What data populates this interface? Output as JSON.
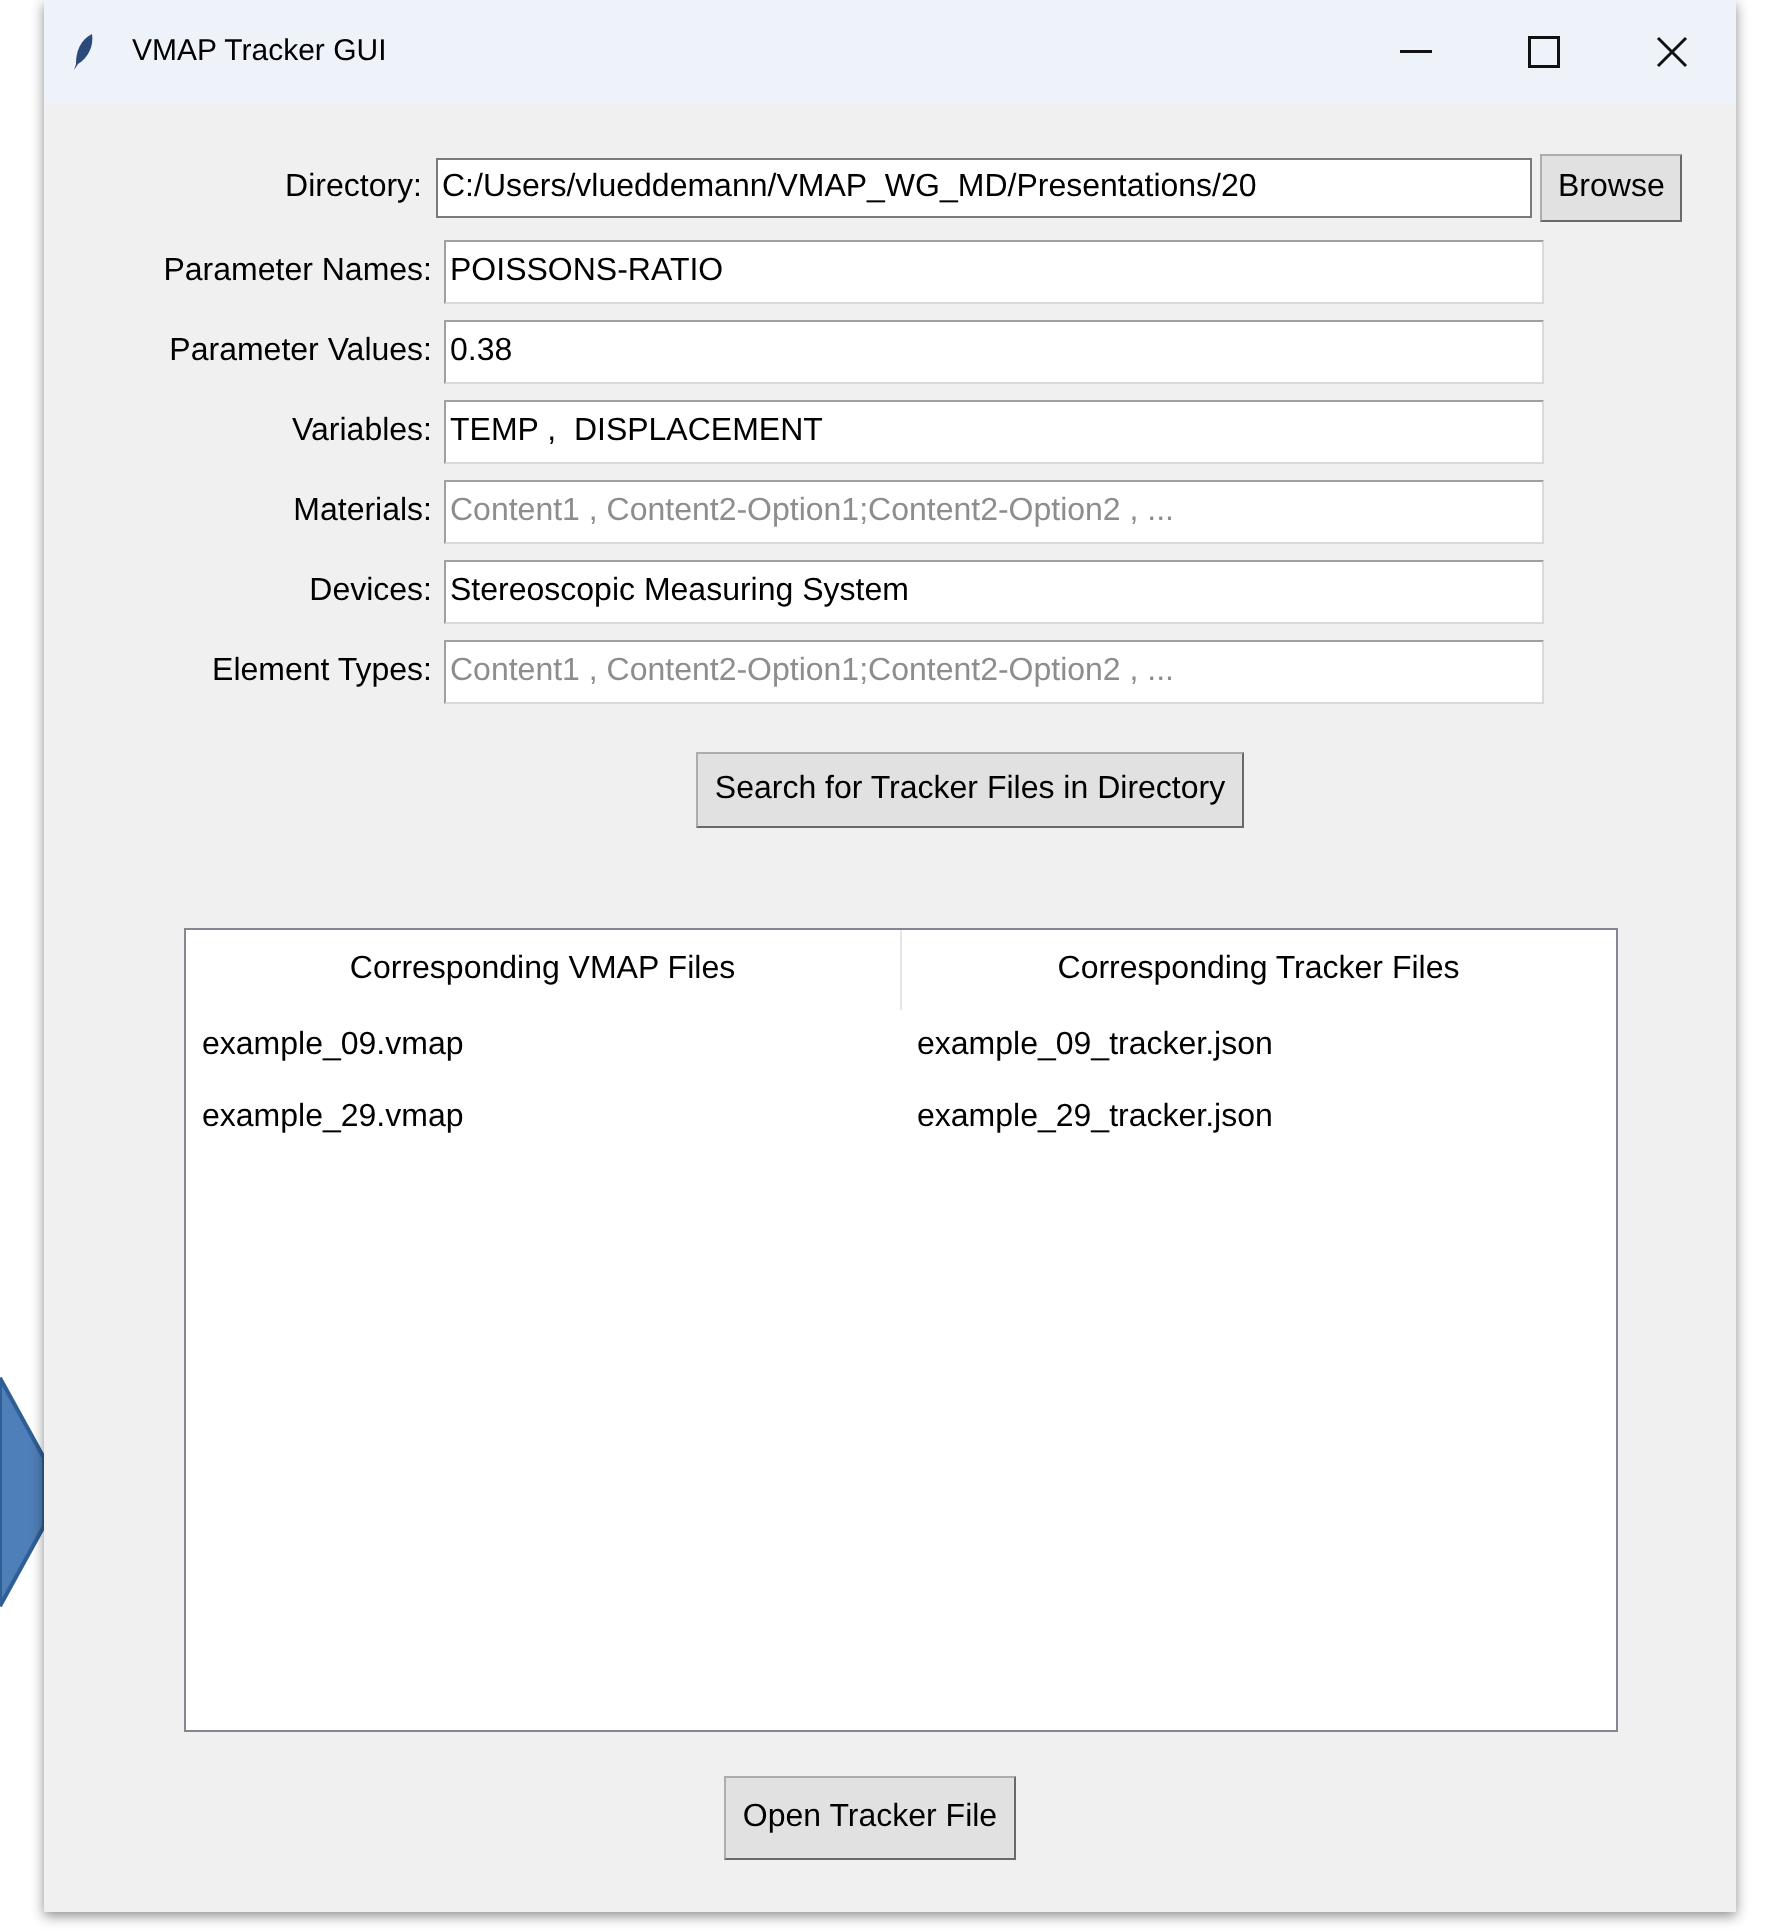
{
  "window": {
    "title": "VMAP Tracker GUI"
  },
  "directory": {
    "label": "Directory:",
    "value": "C:/Users/vlueddemann/VMAP_WG_MD/Presentations/20",
    "button": "Browse"
  },
  "fields": [
    {
      "label": "Parameter Names:",
      "value": "POISSONS-RATIO"
    },
    {
      "label": "Parameter Values:",
      "value": "0.38"
    },
    {
      "label": "Variables:",
      "value": "TEMP ,  DISPLACEMENT"
    },
    {
      "label": "Materials:",
      "placeholder": "Content1 , Content2-Option1;Content2-Option2 , ..."
    },
    {
      "label": "Devices:",
      "value": "Stereoscopic Measuring System"
    },
    {
      "label": "Element Types:",
      "placeholder": "Content1 , Content2-Option1;Content2-Option2 , ..."
    }
  ],
  "search_button": "Search for Tracker Files in Directory",
  "table": {
    "columns": [
      "Corresponding VMAP Files",
      "Corresponding Tracker Files"
    ],
    "rows": [
      [
        "example_09.vmap",
        "example_09_tracker.json"
      ],
      [
        "example_29.vmap",
        "example_29_tracker.json"
      ]
    ]
  },
  "open_button": "Open Tracker File"
}
